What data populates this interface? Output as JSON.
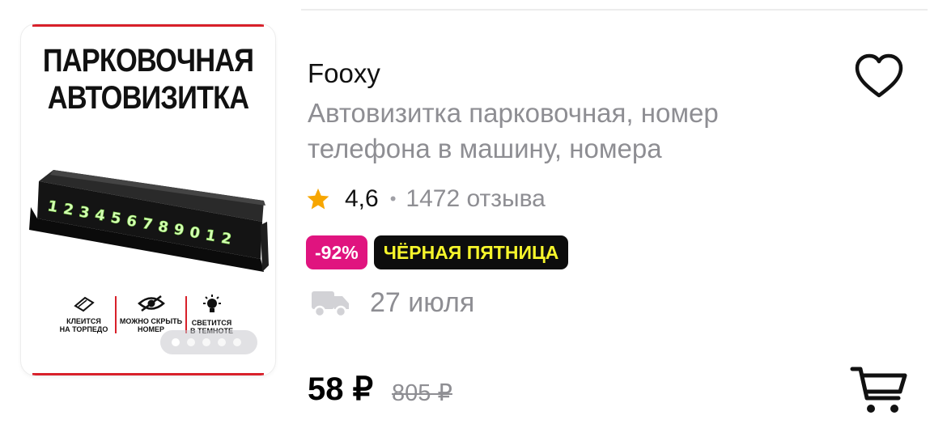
{
  "product": {
    "image": {
      "title_line1": "ПАРКОВОЧНАЯ",
      "title_line2": "АВТОВИЗИТКА",
      "digits": [
        "1",
        "2",
        "3",
        "4",
        "5",
        "6",
        "7",
        "8",
        "9",
        "0",
        "1",
        "2"
      ],
      "features": [
        {
          "line1": "КЛЕИТСЯ",
          "line2": "НА ТОРПЕДО",
          "icon": "tape-icon"
        },
        {
          "line1": "МОЖНО СКРЫТЬ",
          "line2": "НОМЕР",
          "icon": "eye-hidden-icon"
        },
        {
          "line1": "СВЕТИТСЯ",
          "line2": "В ТЕМНОТЕ",
          "icon": "bulb-icon"
        }
      ],
      "carousel": {
        "count": 5,
        "active": 0
      }
    },
    "brand": "Fooxy",
    "title_line1": "Автовизитка парковочная, номер",
    "title_line2": "телефона в машину, номера",
    "rating": "4,6",
    "rating_separator": "•",
    "reviews": "1472 отзыва",
    "discount_badge": "-92%",
    "promo_badge": "ЧЁРНАЯ ПЯТНИЦА",
    "delivery_date": "27 июля",
    "price": "58 ₽",
    "old_price": "805 ₽"
  },
  "icons": {
    "favorite": "heart-icon",
    "rating": "star-icon",
    "delivery": "truck-icon",
    "cart": "cart-icon"
  },
  "colors": {
    "star": "#f7a600",
    "discount": "#e0147f",
    "promo_bg": "#0d0d0d",
    "promo_text": "#f6f52b",
    "muted": "#8e8e93",
    "accent_red": "#d8202a"
  }
}
